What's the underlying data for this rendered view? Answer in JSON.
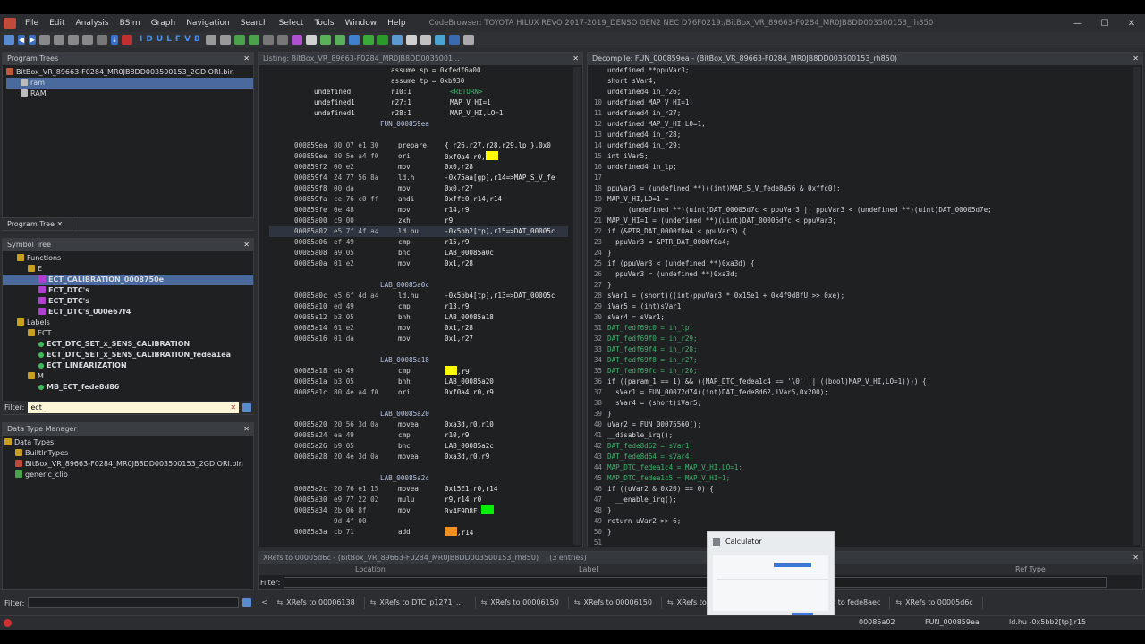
{
  "window": {
    "title": "CodeBrowser: TOYOTA HILUX REVO 2017-2019_DENSO GEN2 NEC D76F0219:/BitBox_VR_89663-F0284_MR0JB8DD003500153_rh850",
    "min": "—",
    "max": "☐",
    "close": "✕"
  },
  "menu": [
    "File",
    "Edit",
    "Analysis",
    "BSim",
    "Graph",
    "Navigation",
    "Search",
    "Select",
    "Tools",
    "Window",
    "Help"
  ],
  "toolbar": {
    "letters": [
      "I",
      "D",
      "U",
      "L",
      "F",
      "V",
      "B"
    ]
  },
  "program_trees": {
    "title": "Program Trees",
    "root": "BitBox_VR_89663-F0284_MR0JB8DD003500153_2GD ORI.bin",
    "items": [
      "ram",
      "RAM"
    ],
    "tab": "Program Tree"
  },
  "symbol_tree": {
    "title": "Symbol Tree",
    "rows": [
      {
        "label": "Functions",
        "indent": 1,
        "kind": "folder"
      },
      {
        "label": "E",
        "indent": 2,
        "kind": "folder"
      },
      {
        "label": "ECT_CALIBRATION_0008750e",
        "indent": 3,
        "kind": "func",
        "sel": true
      },
      {
        "label": "ECT_DTC's",
        "indent": 3,
        "kind": "func"
      },
      {
        "label": "ECT_DTC's",
        "indent": 3,
        "kind": "func"
      },
      {
        "label": "ECT_DTC's_000e67f4",
        "indent": 3,
        "kind": "func"
      },
      {
        "label": "Labels",
        "indent": 1,
        "kind": "folder"
      },
      {
        "label": "ECT",
        "indent": 2,
        "kind": "folder"
      },
      {
        "label": "ECT_DTC_SET_x_SENS_CALIBRATION",
        "indent": 3,
        "kind": "label"
      },
      {
        "label": "ECT_DTC_SET_x_SENS_CALIBRATION_fedea1ea",
        "indent": 3,
        "kind": "label"
      },
      {
        "label": "ECT_LINEARIZATION",
        "indent": 3,
        "kind": "label"
      },
      {
        "label": "M",
        "indent": 2,
        "kind": "folder"
      },
      {
        "label": "MB_ECT_fede8d86",
        "indent": 3,
        "kind": "label"
      }
    ],
    "filter_label": "Filter:",
    "filter_value": "ect_"
  },
  "data_type_manager": {
    "title": "Data Type Manager",
    "rows": [
      "Data Types",
      "BuiltInTypes",
      "BitBox_VR_89663-F0284_MR0JB8DD003500153_2GD ORI.bin",
      "generic_clib"
    ],
    "filter_label": "Filter:"
  },
  "listing": {
    "title": "Listing: BitBox_VR_89663-F0284_MR0JB8DD0035001...",
    "lines": [
      {
        "bytes": "",
        "mn": "",
        "op": "assume sp = 0xfedf6a00",
        "type": "plain"
      },
      {
        "bytes": "",
        "mn": "",
        "op": "assume tp = 0xb930",
        "type": "plain"
      },
      {
        "bytes": "undefined",
        "mn": "r10:1",
        "op": "<RETURN>",
        "type": "var"
      },
      {
        "bytes": "undefined1",
        "mn": "r27:1",
        "op": "MAP_V_HI=1",
        "type": "var"
      },
      {
        "bytes": "undefined1",
        "mn": "r28:1",
        "op": "MAP_V_HI,LO=1",
        "type": "var"
      },
      {
        "bytes": "",
        "mn": "",
        "op": "FUN_000859ea",
        "type": "label"
      },
      {
        "bytes": "",
        "mn": "",
        "op": "",
        "type": "blank"
      },
      {
        "addr": "000859ea",
        "bytes": "80 07 e1 30",
        "mn": "prepare",
        "op": "{ r26,r27,r28,r29,lp },0x0",
        "type": "code"
      },
      {
        "addr": "000859ee",
        "bytes": "80 5e a4 f0",
        "mn": "ori",
        "op": "0xf0a4,r0,",
        "hl": "yellow",
        "type": "code"
      },
      {
        "addr": "000859f2",
        "bytes": "00 e2",
        "mn": "mov",
        "op": "0x0,r28",
        "type": "code"
      },
      {
        "addr": "000859f4",
        "bytes": "24 77 56 8a",
        "mn": "ld.h",
        "op": "-0x75aa[gp],r14=>MAP_S_V_fe",
        "type": "code"
      },
      {
        "addr": "000859f8",
        "bytes": "00 da",
        "mn": "mov",
        "op": "0x0,r27",
        "type": "code"
      },
      {
        "addr": "000859fa",
        "bytes": "ce 76 c0 ff",
        "mn": "andi",
        "op": "0xffc0,r14,r14",
        "type": "code"
      },
      {
        "addr": "000859fe",
        "bytes": "0e 48",
        "mn": "mov",
        "op": "r14,r9",
        "type": "code"
      },
      {
        "addr": "00085a00",
        "bytes": "c9 00",
        "mn": "zxh",
        "op": "r9",
        "type": "code"
      },
      {
        "addr": "00085a02",
        "bytes": "e5 7f 4f a4",
        "mn": "ld.hu",
        "op": "-0x5bb2[tp],r15=>DAT_00005c",
        "type": "code",
        "cur": true
      },
      {
        "addr": "00085a06",
        "bytes": "ef 49",
        "mn": "cmp",
        "op": "r15,r9",
        "type": "code"
      },
      {
        "addr": "00085a08",
        "bytes": "a9 05",
        "mn": "bnc",
        "op": "LAB_00085a0c",
        "type": "code"
      },
      {
        "addr": "00085a0a",
        "bytes": "01 e2",
        "mn": "mov",
        "op": "0x1,r28",
        "type": "code"
      },
      {
        "bytes": "",
        "mn": "",
        "op": "",
        "type": "blank"
      },
      {
        "bytes": "",
        "mn": "",
        "op": "LAB_00085a0c",
        "type": "label"
      },
      {
        "addr": "00085a0c",
        "bytes": "e5 6f 4d a4",
        "mn": "ld.hu",
        "op": "-0x5bb4[tp],r13=>DAT_00005c",
        "type": "code"
      },
      {
        "addr": "00085a10",
        "bytes": "ed 49",
        "mn": "cmp",
        "op": "r13,r9",
        "type": "code"
      },
      {
        "addr": "00085a12",
        "bytes": "b3 05",
        "mn": "bnh",
        "op": "LAB_00085a18",
        "type": "code"
      },
      {
        "addr": "00085a14",
        "bytes": "01 e2",
        "mn": "mov",
        "op": "0x1,r28",
        "type": "code"
      },
      {
        "addr": "00085a16",
        "bytes": "01 da",
        "mn": "mov",
        "op": "0x1,r27",
        "type": "code"
      },
      {
        "bytes": "",
        "mn": "",
        "op": "",
        "type": "blank"
      },
      {
        "bytes": "",
        "mn": "",
        "op": "LAB_00085a18",
        "type": "label"
      },
      {
        "addr": "00085a18",
        "bytes": "eb 49",
        "mn": "cmp",
        "op": ",r9",
        "hl_pre": "yellow",
        "type": "code"
      },
      {
        "addr": "00085a1a",
        "bytes": "b3 05",
        "mn": "bnh",
        "op": "LAB_00085a20",
        "type": "code"
      },
      {
        "addr": "00085a1c",
        "bytes": "80 4e a4 f0",
        "mn": "ori",
        "op": "0xf0a4,r0,r9",
        "type": "code"
      },
      {
        "bytes": "",
        "mn": "",
        "op": "",
        "type": "blank"
      },
      {
        "bytes": "",
        "mn": "",
        "op": "LAB_00085a20",
        "type": "label"
      },
      {
        "addr": "00085a20",
        "bytes": "20 56 3d 0a",
        "mn": "movea",
        "op": "0xa3d,r0,r10",
        "type": "code"
      },
      {
        "addr": "00085a24",
        "bytes": "ea 49",
        "mn": "cmp",
        "op": "r10,r9",
        "type": "code"
      },
      {
        "addr": "00085a26",
        "bytes": "b9 05",
        "mn": "bnc",
        "op": "LAB_00085a2c",
        "type": "code"
      },
      {
        "addr": "00085a28",
        "bytes": "20 4e 3d 0a",
        "mn": "movea",
        "op": "0xa3d,r0,r9",
        "type": "code"
      },
      {
        "bytes": "",
        "mn": "",
        "op": "",
        "type": "blank"
      },
      {
        "bytes": "",
        "mn": "",
        "op": "LAB_00085a2c",
        "type": "label"
      },
      {
        "addr": "00085a2c",
        "bytes": "20 76 e1 15",
        "mn": "movea",
        "op": "0x15E1,r0,r14",
        "type": "code"
      },
      {
        "addr": "00085a30",
        "bytes": "e9 77 22 02",
        "mn": "mulu",
        "op": "r9,r14,r0",
        "type": "code"
      },
      {
        "addr": "00085a34",
        "bytes": "2b 06 8f",
        "mn": "mov",
        "op": "0x4F9D8F,",
        "hl": "green",
        "type": "code"
      },
      {
        "bytes": "9d 4f 00",
        "mn": "",
        "op": "",
        "type": "cont"
      },
      {
        "addr": "00085a3a",
        "bytes": "cb 71",
        "mn": "add",
        "op": ",r14",
        "hl_pre": "orange",
        "type": "code"
      }
    ]
  },
  "decompile": {
    "title": "Decompile: FUN_000859ea - (BitBox_VR_89663-F0284_MR0JB8DD003500153_rh850)",
    "lines": [
      {
        "n": "",
        "t": "undefined **ppuVar3;"
      },
      {
        "n": "",
        "t": "short sVar4;"
      },
      {
        "n": "",
        "t": "undefined4 in_r26;"
      },
      {
        "n": "10",
        "t": "undefined MAP_V_HI=1;"
      },
      {
        "n": "11",
        "t": "undefined4 in_r27;"
      },
      {
        "n": "12",
        "t": "undefined MAP_V_HI,LO=1;"
      },
      {
        "n": "13",
        "t": "undefined4 in_r28;"
      },
      {
        "n": "14",
        "t": "undefined4 in_r29;"
      },
      {
        "n": "15",
        "t": "int iVar5;"
      },
      {
        "n": "16",
        "t": "undefined4 in_lp;"
      },
      {
        "n": "17",
        "t": ""
      },
      {
        "n": "18",
        "t": "ppuVar3 = (undefined **)((int)MAP_S_V_fede8a56 & 0xffc0);"
      },
      {
        "n": "19",
        "t": "MAP_V_HI,LO=1 ="
      },
      {
        "n": "20",
        "t": "     (undefined **)(uint)DAT_00005d7c < ppuVar3 || ppuVar3 < (undefined **)(uint)DAT_00005d7e;"
      },
      {
        "n": "21",
        "t": "MAP_V_HI=1 = (undefined **)(uint)DAT_00005d7c < ppuVar3;"
      },
      {
        "n": "22",
        "t": "if (&PTR_DAT_0000f0a4 < ppuVar3) {"
      },
      {
        "n": "23",
        "t": "  ppuVar3 = &PTR_DAT_0000f0a4;"
      },
      {
        "n": "24",
        "t": "}"
      },
      {
        "n": "25",
        "t": "if (ppuVar3 < (undefined **)0xa3d) {"
      },
      {
        "n": "26",
        "t": "  ppuVar3 = (undefined **)0xa3d;"
      },
      {
        "n": "27",
        "t": "}"
      },
      {
        "n": "28",
        "t": "sVar1 = (short)((int)ppuVar3 * 0x15e1 + 0x4f9d8fU >> 0xe);"
      },
      {
        "n": "29",
        "t": "iVar5 = (int)sVar1;"
      },
      {
        "n": "30",
        "t": "sVar4 = sVar1;"
      },
      {
        "n": "31",
        "t": "DAT_fedf69c0 = in_lp;"
      },
      {
        "n": "32",
        "t": "DAT_fedf69f0 = in_r29;"
      },
      {
        "n": "33",
        "t": "DAT_fedf69f4 = in_r28;"
      },
      {
        "n": "34",
        "t": "DAT_fedf69f8 = in_r27;"
      },
      {
        "n": "35",
        "t": "DAT_fedf69fc = in_r26;"
      },
      {
        "n": "36",
        "t": "if ((param_1 == 1) && ((MAP_DTC_fedea1c4 == '\\0' || ((bool)MAP_V_HI,LO=1)))) {"
      },
      {
        "n": "37",
        "t": "  sVar1 = FUN_00072d74((int)DAT_fede8d62,iVar5,0x200);"
      },
      {
        "n": "38",
        "t": "  sVar4 = (short)iVar5;"
      },
      {
        "n": "39",
        "t": "}"
      },
      {
        "n": "40",
        "t": "uVar2 = FUN_00075560();"
      },
      {
        "n": "41",
        "t": "__disable_irq();"
      },
      {
        "n": "42",
        "t": "DAT_fede8d62 = sVar1;"
      },
      {
        "n": "43",
        "t": "DAT_fede8d64 = sVar4;"
      },
      {
        "n": "44",
        "t": "MAP_DTC_fedea1c4 = MAP_V_HI,LO=1;"
      },
      {
        "n": "45",
        "t": "MAP_DTC_fedea1c5 = MAP_V_HI=1;"
      },
      {
        "n": "46",
        "t": "if ((uVar2 & 0x20) == 0) {"
      },
      {
        "n": "47",
        "t": "  __enable_irq();"
      },
      {
        "n": "48",
        "t": "}"
      },
      {
        "n": "49",
        "t": "return uVar2 >> 6;"
      },
      {
        "n": "50",
        "t": "}"
      },
      {
        "n": "51",
        "t": ""
      }
    ]
  },
  "xrefs": {
    "title": "XRefs to 00005d6c - (BitBox_VR_89663-F0284_MR0JB8DD003500153_rh850)",
    "count": "(3 entries)",
    "cols": [
      "Location",
      "Label",
      "Ref Type"
    ],
    "filter_label": "Filter:"
  },
  "bottom_tabs": [
    "XRefs to 00006138",
    "XRefs to DTC_p1271_TUR...",
    "XRefs to 00006150",
    "XRefs to 00006150",
    "XRefs to",
    "XRefs to ffff802c",
    "XRefs to fede8aec",
    "XRefs to 00005d6c"
  ],
  "calculator": {
    "title": "Calculator"
  },
  "status": {
    "addr": "00085a02",
    "func": "FUN_000859ea",
    "instr": "ld.hu -0x5bb2[tp],r15"
  }
}
